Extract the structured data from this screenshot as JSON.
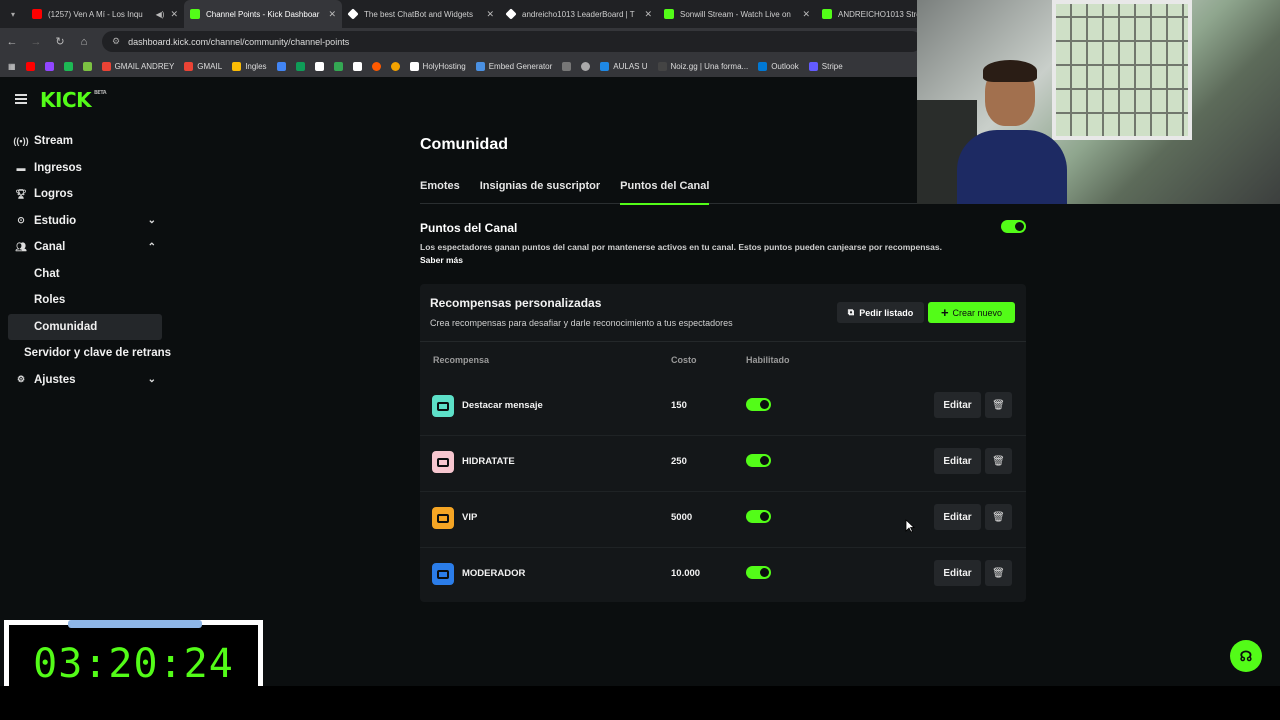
{
  "browser": {
    "tabs": [
      {
        "title": "(1257) Ven A Mí - Los Inqu",
        "favicon_color": "#ff0000",
        "active": false
      },
      {
        "title": "Channel Points - Kick Dashboar",
        "favicon_color": "#53fc18",
        "active": true
      },
      {
        "title": "The best ChatBot and Widgets",
        "favicon_color": "#ffffff",
        "active": false
      },
      {
        "title": "andreicho1013 LeaderBoard | T",
        "favicon_color": "#ffffff",
        "active": false
      },
      {
        "title": "Sonwill Stream - Watch Live on",
        "favicon_color": "#53fc18",
        "active": false
      },
      {
        "title": "ANDREICHO1013 Strea",
        "favicon_color": "#53fc18",
        "active": false
      }
    ],
    "url": "dashboard.kick.com/channel/community/channel-points",
    "bookmarks": [
      {
        "label": "",
        "color": "#ff0000"
      },
      {
        "label": "",
        "color": "#9146ff"
      },
      {
        "label": "",
        "color": "#1db954"
      },
      {
        "label": "",
        "color": "#7cc242"
      },
      {
        "label": "GMAIL ANDREY",
        "color": "#ea4335"
      },
      {
        "label": "GMAIL",
        "color": "#ea4335"
      },
      {
        "label": "Ingles",
        "color": "#fbbc05"
      },
      {
        "label": "",
        "color": "#4285f4"
      },
      {
        "label": "",
        "color": "#0f9d58"
      },
      {
        "label": "",
        "color": "#ffffff"
      },
      {
        "label": "",
        "color": "#34a853"
      },
      {
        "label": "",
        "color": "#ffffff"
      },
      {
        "label": "",
        "color": "#ff5a00"
      },
      {
        "label": "",
        "color": "#f4a300"
      },
      {
        "label": "HolyHosting",
        "color": "#ffffff"
      },
      {
        "label": "Embed Generator",
        "color": "#4a90e2"
      },
      {
        "label": "",
        "color": "#777777"
      },
      {
        "label": "",
        "color": "#aaaaaa"
      },
      {
        "label": "AULAS U",
        "color": "#1e88e5"
      },
      {
        "label": "Noiz.gg | Una forma...",
        "color": "#222222"
      },
      {
        "label": "Outlook",
        "color": "#0078d4"
      },
      {
        "label": "Stripe",
        "color": "#635bff"
      }
    ]
  },
  "kick": {
    "logo": "KICK",
    "logo_badge": "BETA"
  },
  "sidebar": {
    "items": [
      {
        "label": "Stream",
        "icon": "broadcast-icon",
        "chevron": ""
      },
      {
        "label": "Ingresos",
        "icon": "money-icon",
        "chevron": ""
      },
      {
        "label": "Logros",
        "icon": "trophy-icon",
        "chevron": ""
      },
      {
        "label": "Estudio",
        "icon": "studio-icon",
        "chevron": "down"
      },
      {
        "label": "Canal",
        "icon": "users-icon",
        "chevron": "up"
      }
    ],
    "sub_items": [
      {
        "label": "Chat",
        "active": false
      },
      {
        "label": "Roles",
        "active": false
      },
      {
        "label": "Comunidad",
        "active": true
      }
    ],
    "server_item": "Servidor y clave de retrans",
    "settings_item": "Ajustes"
  },
  "main": {
    "title": "Comunidad",
    "tabs": [
      {
        "label": "Emotes",
        "active": false
      },
      {
        "label": "Insignias de suscriptor",
        "active": false
      },
      {
        "label": "Puntos del Canal",
        "active": true
      }
    ],
    "section_title": "Puntos del Canal",
    "section_desc": "Los espectadores ganan puntos del canal por mantenerse activos en tu canal. Estos puntos pueden canjearse por recompensas.",
    "learn_more": "Saber más",
    "channel_points_enabled": true
  },
  "rewards": {
    "title": "Recompensas personalizadas",
    "subtitle": "Crea recompensas para desafiar y darle reconocimiento a tus espectadores",
    "request_list_label": "Pedir listado",
    "create_label": "Crear nuevo",
    "columns": {
      "reward": "Recompensa",
      "cost": "Costo",
      "enabled": "Habilitado"
    },
    "edit_label": "Editar",
    "rows": [
      {
        "name": "Destacar mensaje",
        "cost": "150",
        "enabled": true,
        "color": "#5de0c8"
      },
      {
        "name": "HIDRATATE",
        "cost": "250",
        "enabled": true,
        "color": "#f7c6cf"
      },
      {
        "name": "VIP",
        "cost": "5000",
        "enabled": true,
        "color": "#f5a524"
      },
      {
        "name": "MODERADOR",
        "cost": "10.000",
        "enabled": true,
        "color": "#2b7de9"
      }
    ]
  },
  "overlay": {
    "timer": "03:20:24"
  },
  "colors": {
    "accent": "#53fc18",
    "background": "#0b0e0f",
    "card": "#141719"
  }
}
